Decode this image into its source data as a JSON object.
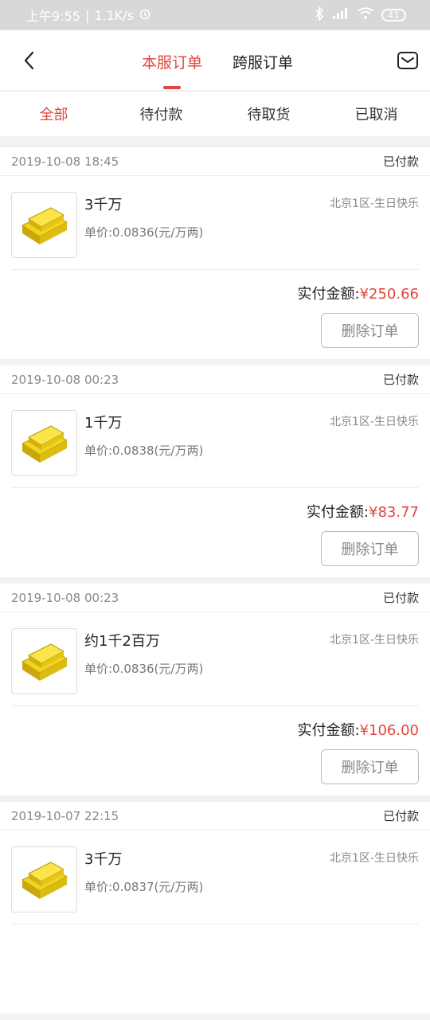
{
  "status_bar": {
    "time": "上午9:55",
    "speed": "1.1K/s",
    "battery": "41"
  },
  "header": {
    "tabs": [
      {
        "label": "本服订单",
        "active": true
      },
      {
        "label": "跨服订单",
        "active": false
      }
    ],
    "icons": {
      "back": "chevron-left-icon",
      "mail": "mail-icon"
    }
  },
  "sub_tabs": [
    {
      "label": "全部",
      "active": true
    },
    {
      "label": "待付款",
      "active": false
    },
    {
      "label": "待取货",
      "active": false
    },
    {
      "label": "已取消",
      "active": false
    }
  ],
  "orders": [
    {
      "time": "2019-10-08 18:45",
      "status": "已付款",
      "name": "3千万",
      "unit_price": "单价:0.0836(元/万两)",
      "server": "北京1区-生日快乐",
      "paid_label": "实付金额:",
      "paid_amount": "¥250.66",
      "delete_label": "删除订单"
    },
    {
      "time": "2019-10-08 00:23",
      "status": "已付款",
      "name": "1千万",
      "unit_price": "单价:0.0838(元/万两)",
      "server": "北京1区-生日快乐",
      "paid_label": "实付金额:",
      "paid_amount": "¥83.77",
      "delete_label": "删除订单"
    },
    {
      "time": "2019-10-08 00:23",
      "status": "已付款",
      "name": "约1千2百万",
      "unit_price": "单价:0.0836(元/万两)",
      "server": "北京1区-生日快乐",
      "paid_label": "实付金额:",
      "paid_amount": "¥106.00",
      "delete_label": "删除订单"
    },
    {
      "time": "2019-10-07 22:15",
      "status": "已付款",
      "name": "3千万",
      "unit_price": "单价:0.0837(元/万两)",
      "server": "北京1区-生日快乐"
    }
  ],
  "colors": {
    "accent": "#e0463f"
  }
}
